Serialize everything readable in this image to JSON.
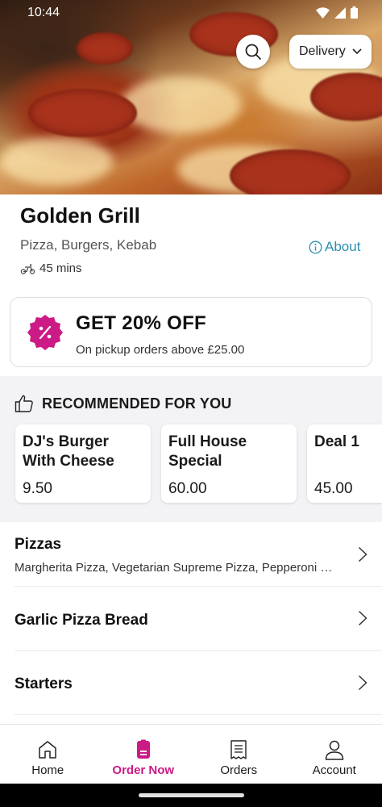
{
  "status_bar": {
    "time": "10:44"
  },
  "header": {
    "delivery_label": "Delivery"
  },
  "restaurant": {
    "name": "Golden Grill",
    "cuisine": "Pizza, Burgers, Kebab",
    "about_label": "About",
    "eta": "45 mins"
  },
  "promo": {
    "title": "GET 20% OFF",
    "subtitle": "On pickup orders above £25.00",
    "accent": "#cc1a86"
  },
  "recommended": {
    "title": "RECOMMENDED FOR YOU",
    "items": [
      {
        "name": "DJ's Burger With Cheese",
        "price": "9.50"
      },
      {
        "name": "Full House Special",
        "price": "60.00"
      },
      {
        "name": "Deal 1",
        "price": "45.00"
      }
    ]
  },
  "categories": [
    {
      "title": "Pizzas",
      "description": "Margherita Pizza, Vegetarian Supreme Pizza, Pepperoni Pizza"
    },
    {
      "title": "Garlic Pizza Bread",
      "description": ""
    },
    {
      "title": "Starters",
      "description": ""
    }
  ],
  "bottom_nav": [
    {
      "label": "Home",
      "icon": "home-icon",
      "active": false
    },
    {
      "label": "Order Now",
      "icon": "order-icon",
      "active": true
    },
    {
      "label": "Orders",
      "icon": "receipt-icon",
      "active": false
    },
    {
      "label": "Account",
      "icon": "account-icon",
      "active": false
    }
  ],
  "colors": {
    "accent": "#cc1a86",
    "link": "#2b8fb0"
  }
}
